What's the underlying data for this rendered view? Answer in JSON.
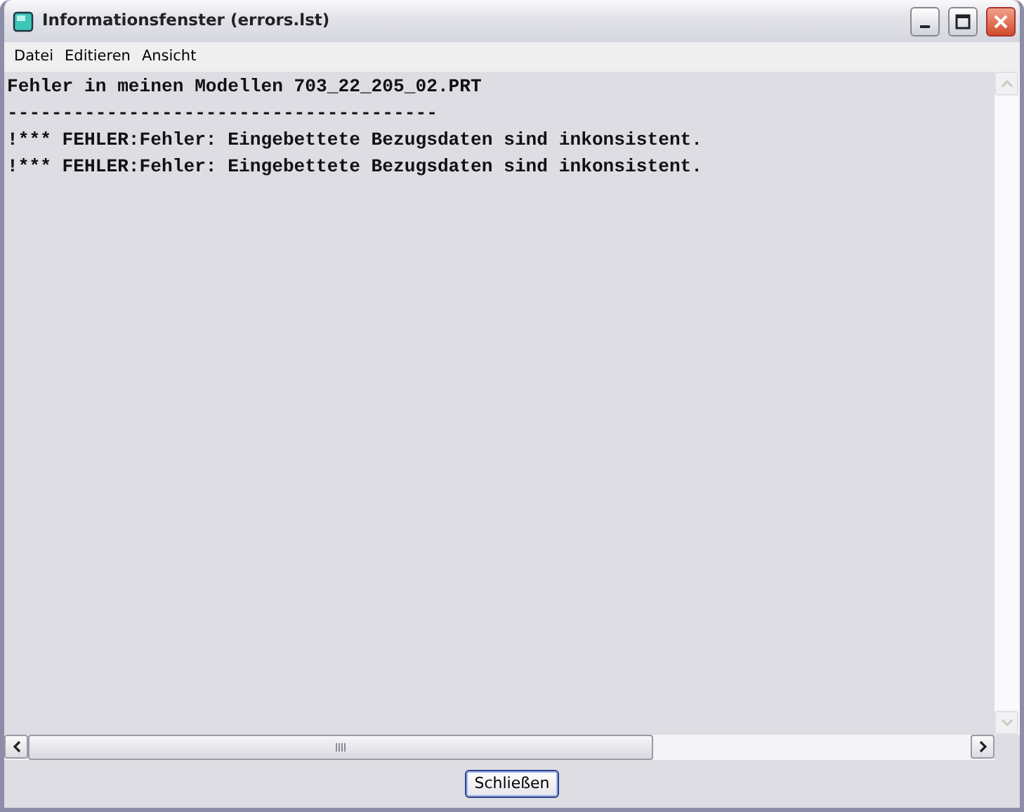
{
  "window": {
    "title": "Informationsfenster (errors.lst)"
  },
  "menu": [
    "Datei",
    "Editieren",
    "Ansicht"
  ],
  "lines": [
    "Fehler in meinen Modellen 703_22_205_02.PRT",
    "---------------------------------------",
    "!*** FEHLER:Fehler: Eingebettete Bezugsdaten sind inkonsistent.",
    "!*** FEHLER:Fehler: Eingebettete Bezugsdaten sind inkonsistent."
  ],
  "buttons": [
    "Schließen"
  ]
}
